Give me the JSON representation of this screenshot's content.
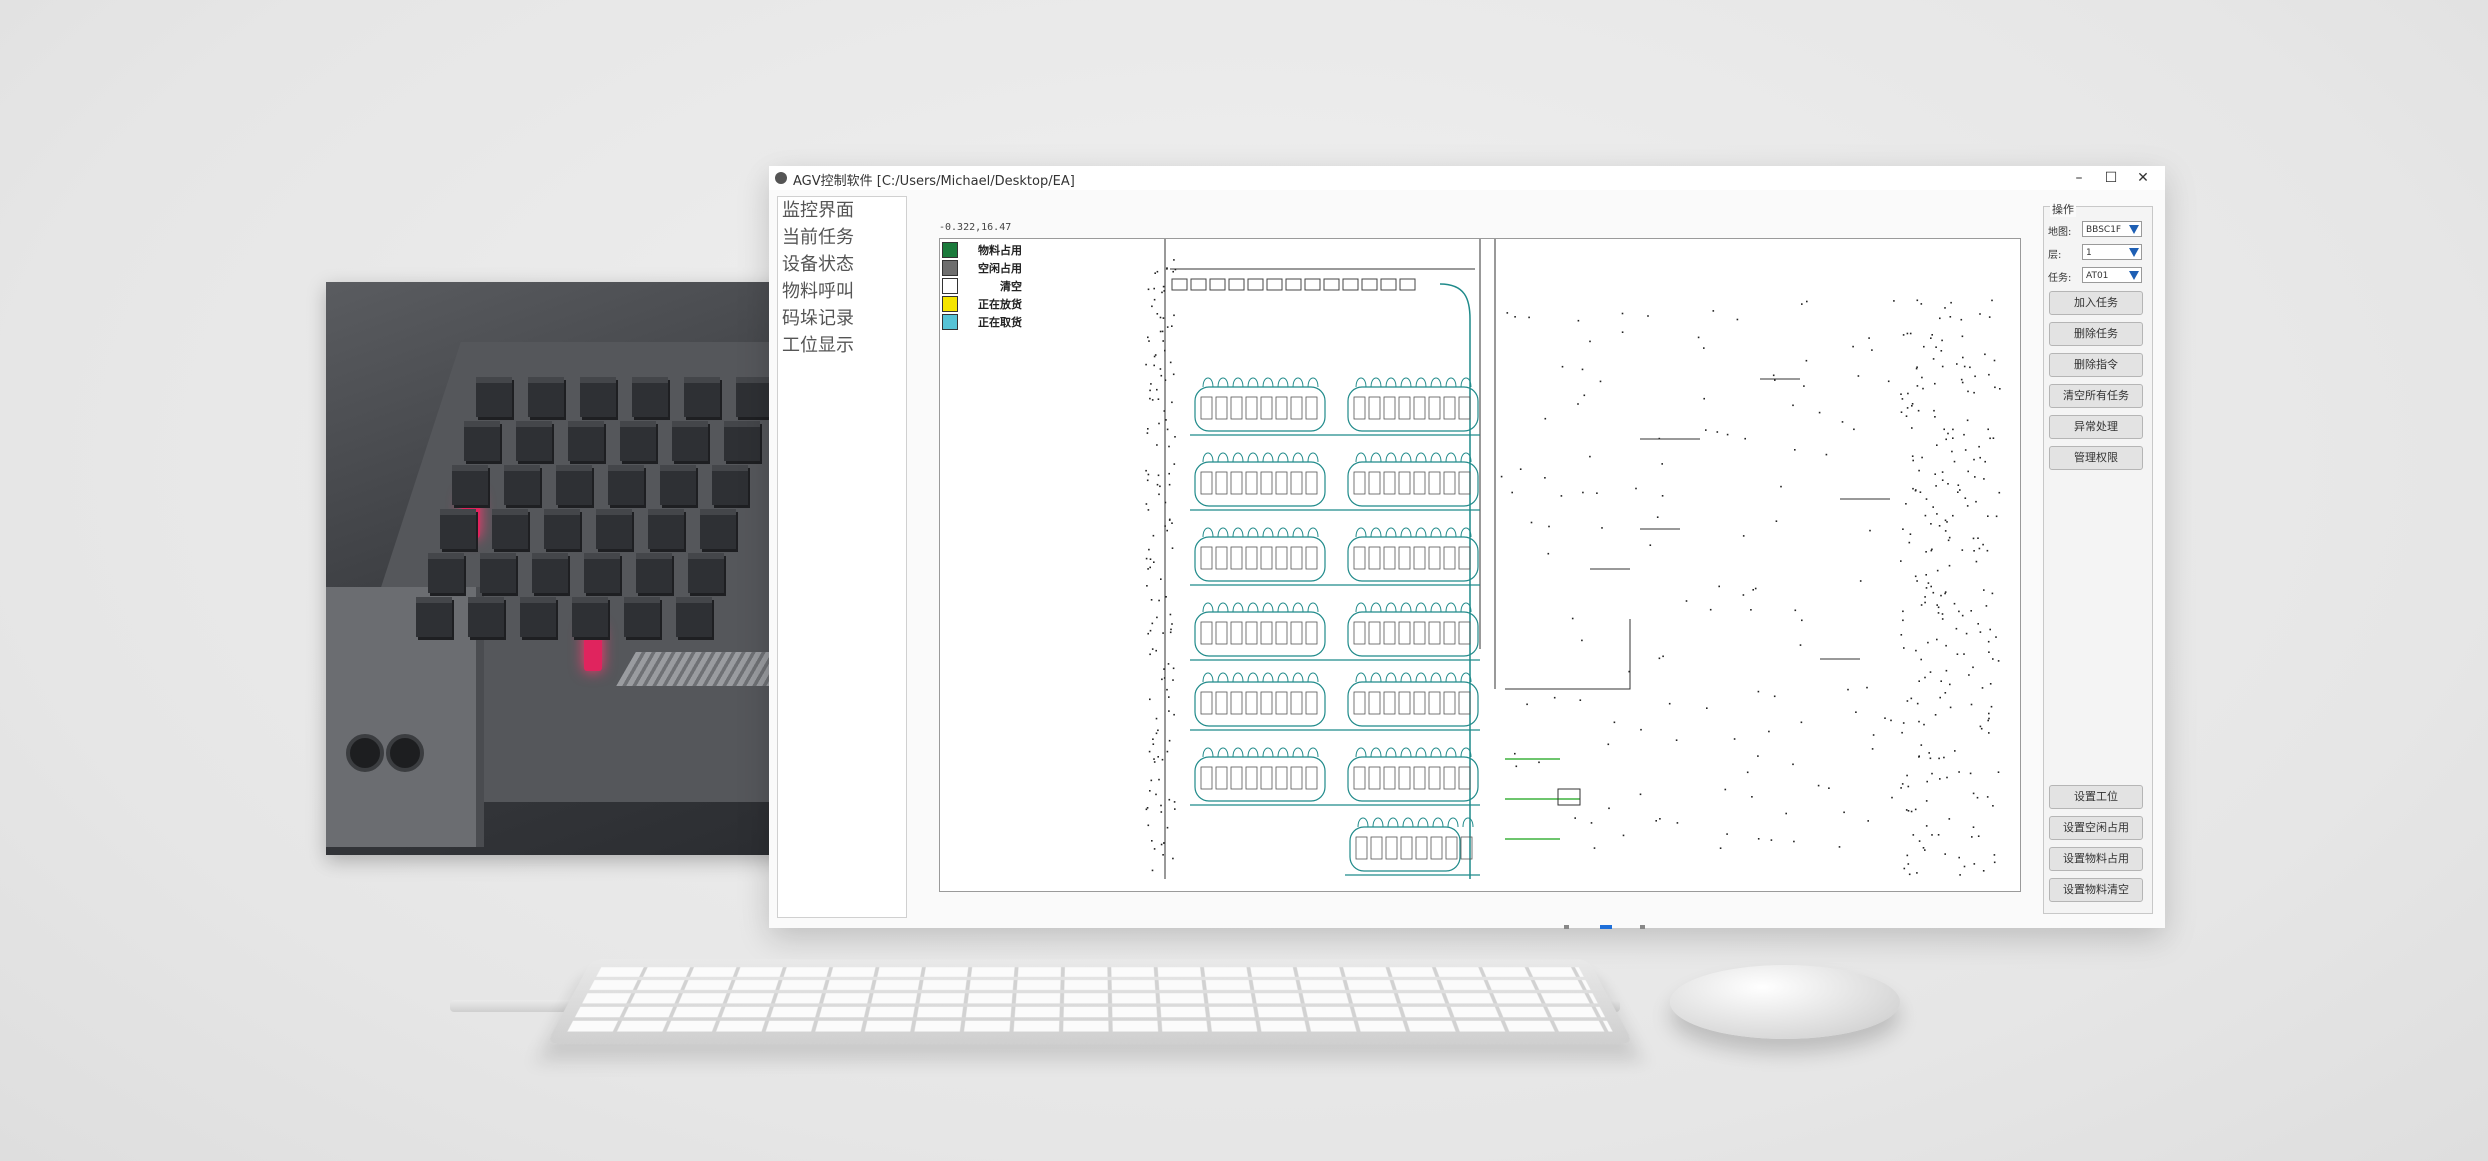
{
  "window": {
    "title": "AGV控制软件 [C:/Users/Michael/Desktop/EA]",
    "minimize": "–",
    "maximize": "☐",
    "close": "✕"
  },
  "nav": [
    "监控界面",
    "当前任务",
    "设备状态",
    "物料呼叫",
    "码垛记录",
    "工位显示"
  ],
  "map": {
    "coordinate": "-0.322,16.47",
    "legend": [
      {
        "label": "物料占用",
        "color": "#1b7a3b"
      },
      {
        "label": "空闲占用",
        "color": "#6e6e6e"
      },
      {
        "label": "清空",
        "color": "#ffffff"
      },
      {
        "label": "正在放货",
        "color": "#f5e500"
      },
      {
        "label": "正在取货",
        "color": "#56c3d6"
      }
    ],
    "route_color": "#1f8a8a",
    "active_route_color": "#3fb23f"
  },
  "ops": {
    "title": "操作",
    "fields": [
      {
        "label": "地图:",
        "value": "BBSC1F"
      },
      {
        "label": "层:",
        "value": "1"
      },
      {
        "label": "任务:",
        "value": "AT01"
      }
    ],
    "top_buttons": [
      "加入任务",
      "删除任务",
      "删除指令",
      "清空所有任务",
      "异常处理",
      "管理权限"
    ],
    "bottom_buttons": [
      "设置工位",
      "设置空闲占用",
      "设置物料占用",
      "设置物料清空"
    ]
  }
}
